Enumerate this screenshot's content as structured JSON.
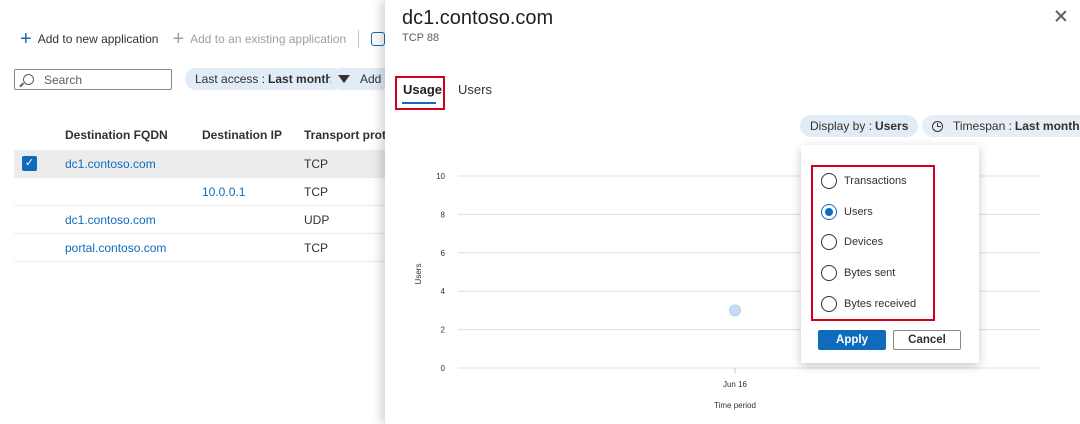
{
  "toolbar": {
    "add_new": "Add to new application",
    "add_existing": "Add to an existing application",
    "chat_icon": "chat-icon"
  },
  "search": {
    "placeholder": "Search"
  },
  "filters": {
    "last_access_label": "Last access :",
    "last_access_value": "Last month",
    "add_filter": "Add"
  },
  "table": {
    "headers": [
      "Destination FQDN",
      "Destination IP",
      "Transport protoco"
    ],
    "rows": [
      {
        "fqdn": "dc1.contoso.com",
        "ip": "",
        "proto": "TCP",
        "selected": true
      },
      {
        "fqdn": "",
        "ip": "10.0.0.1",
        "proto": "TCP",
        "selected": false
      },
      {
        "fqdn": "dc1.contoso.com",
        "ip": "",
        "proto": "UDP",
        "selected": false
      },
      {
        "fqdn": "portal.contoso.com",
        "ip": "",
        "proto": "TCP",
        "selected": false
      }
    ]
  },
  "panel": {
    "title": "dc1.contoso.com",
    "subtitle": "TCP 88",
    "tabs": [
      "Usage",
      "Users"
    ],
    "active_tab": "Usage",
    "display_by_label": "Display by :",
    "display_by_value": "Users",
    "timespan_label": "Timespan :",
    "timespan_value": "Last month"
  },
  "dropdown": {
    "options": [
      "Transactions",
      "Users",
      "Devices",
      "Bytes sent",
      "Bytes received"
    ],
    "selected": "Users",
    "apply": "Apply",
    "cancel": "Cancel"
  },
  "chart_data": {
    "type": "scatter",
    "title": "",
    "xlabel": "Time period",
    "ylabel": "Users",
    "x_ticks": [
      "Jun 16"
    ],
    "y_ticks": [
      0,
      2,
      4,
      6,
      8,
      10
    ],
    "ylim": [
      0,
      10
    ],
    "series": [
      {
        "points": [
          {
            "x": "Jun 16",
            "y": 3
          }
        ]
      }
    ],
    "grid": true,
    "point_color": "#c7dcf3"
  },
  "colors": {
    "accent": "#0f6cbd",
    "highlight_box": "#d0021b",
    "pill_bg": "#e1ecf7"
  }
}
